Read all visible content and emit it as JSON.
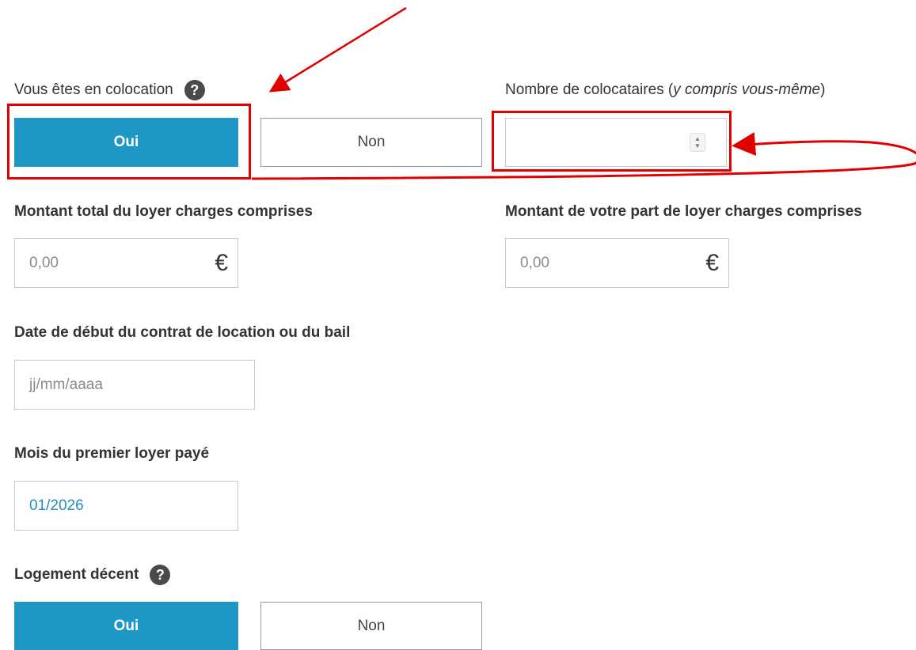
{
  "colocation": {
    "label": "Vous êtes en colocation",
    "help_icon": "question-icon",
    "yes": "Oui",
    "no": "Non",
    "selected": "Oui"
  },
  "colocataires": {
    "label_main": "Nombre de colocataires (",
    "label_italic": "y compris vous-même",
    "label_end": ")",
    "value": ""
  },
  "loyer_total": {
    "label": "Montant total du loyer charges comprises",
    "placeholder": "0,00",
    "currency": "€"
  },
  "loyer_part": {
    "label": "Montant de votre part de loyer charges comprises",
    "placeholder": "0,00",
    "currency": "€"
  },
  "date_debut": {
    "label": "Date de début du contrat de location ou du bail",
    "placeholder": "jj/mm/aaaa"
  },
  "premier_loyer": {
    "label": "Mois du premier loyer payé",
    "value": "01/2026"
  },
  "logement": {
    "label": "Logement décent",
    "help_icon": "question-icon",
    "yes": "Oui",
    "no": "Non",
    "selected": "Oui"
  },
  "colors": {
    "accent": "#1f97c4",
    "annotation": "#e00000"
  }
}
